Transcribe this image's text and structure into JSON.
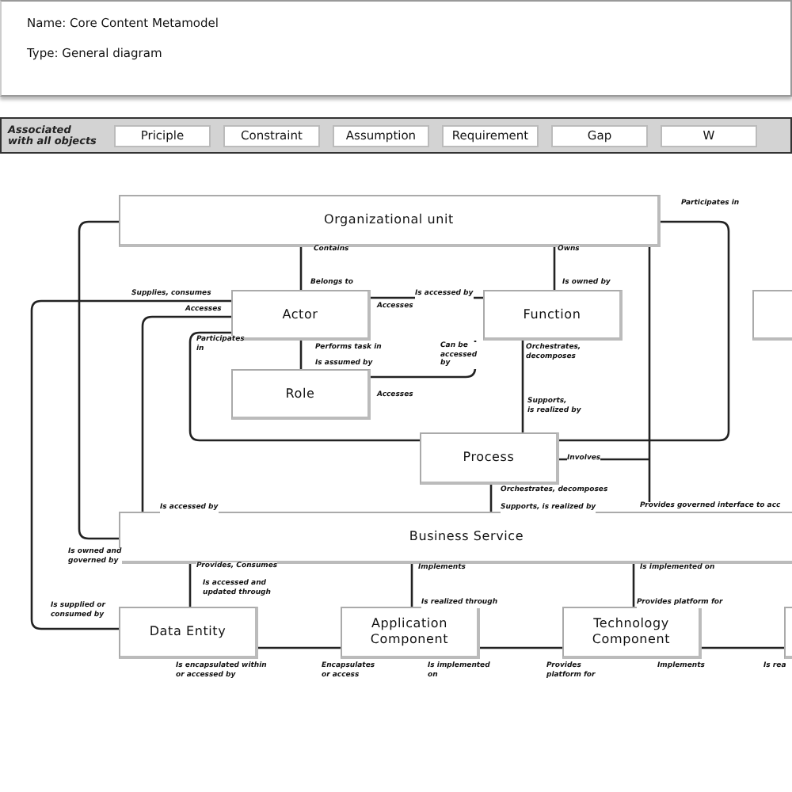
{
  "header": {
    "name_line": "Name: Core Content Metamodel",
    "type_line": "Type: General diagram"
  },
  "toolbar": {
    "caption": "Associated\nwith all objects",
    "buttons": [
      "Priciple",
      "Constraint",
      "Assumption",
      "Requirement",
      "Gap",
      "W"
    ]
  },
  "diagram": {
    "nodes": [
      {
        "kind": "entity",
        "label": "Organizational unit"
      },
      {
        "kind": "entity",
        "label": "Actor"
      },
      {
        "kind": "entity",
        "label": "Function"
      },
      {
        "kind": "partial"
      },
      {
        "kind": "entity",
        "label": "Role"
      },
      {
        "kind": "entity",
        "label": "Process"
      },
      {
        "kind": "entity",
        "label": "Business Service"
      },
      {
        "kind": "entity",
        "label": "Data Entity"
      },
      {
        "kind": "entity",
        "label": "Application\nComponent"
      },
      {
        "kind": "entity",
        "label": "Technology\nComponent"
      },
      {
        "kind": "partial"
      }
    ],
    "edge_labels": [
      "Participates in",
      "Contains",
      "Owns",
      "Belongs to",
      "Is owned by",
      "Supplies, consumes",
      "Is accessed by",
      "Accesses",
      "Accesses",
      "Participates\nin",
      "Performs task in",
      "Is assumed by",
      "Can be\naccessed\nby",
      "Orchestrates,\ndecomposes",
      "Accesses",
      "Supports,\nis realized by",
      "Involves",
      "Orchestrates, decomposes",
      "Is accessed by",
      "Supports, is realized by",
      "Provides governed interface to acc",
      "Is owned and\ngoverned by",
      "Provides, Consumes",
      "Is accessed and\nupdated through",
      "Is supplied or\nconsumed by",
      "Implements",
      "Is realized through",
      "Is implemented on",
      "Provides platform for",
      "Is encapsulated within\nor accessed by",
      "Encapsulates\nor access",
      "Is implemented\non",
      "Provides\nplatform for",
      "Implements",
      "Is rea"
    ]
  }
}
